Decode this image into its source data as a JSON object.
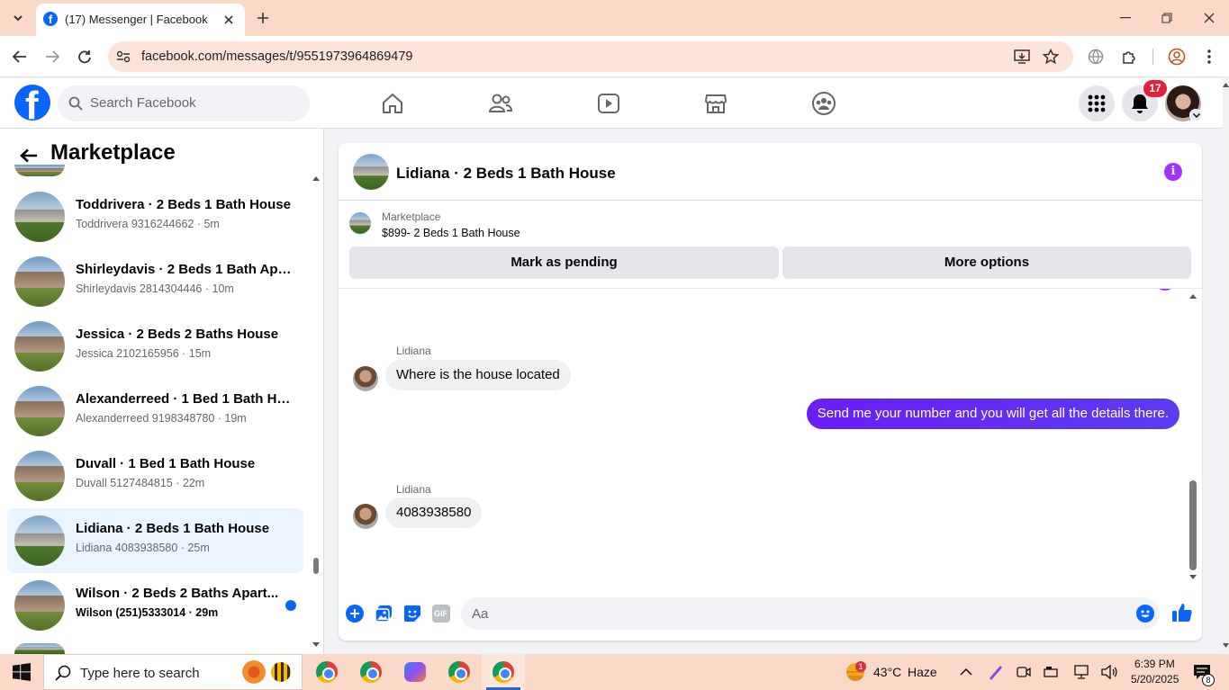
{
  "browser": {
    "tab_title": "(17) Messenger | Facebook",
    "url": "facebook.com/messages/t/9551973964869479"
  },
  "fb": {
    "search_placeholder": "Search Facebook",
    "notification_count": "17"
  },
  "sidebar": {
    "title": "Marketplace",
    "conversations": [
      {
        "name": "Toddrivera · 2 Beds 1 Bath House",
        "sub": "Toddrivera 9316244662 · 5m",
        "unread": false,
        "active": false
      },
      {
        "name": "Shirleydavis · 2 Beds 1 Bath Apar...",
        "sub": "Shirleydavis 2814304446 · 10m",
        "unread": false,
        "active": false
      },
      {
        "name": "Jessica · 2 Beds 2 Baths House",
        "sub": "Jessica 2102165956 · 15m",
        "unread": false,
        "active": false
      },
      {
        "name": "Alexanderreed · 1 Bed 1 Bath Ho...",
        "sub": "Alexanderreed 9198348780 · 19m",
        "unread": false,
        "active": false
      },
      {
        "name": "Duvall · 1 Bed 1 Bath House",
        "sub": "Duvall 5127484815 · 22m",
        "unread": false,
        "active": false
      },
      {
        "name": "Lidiana · 2 Beds 1 Bath House",
        "sub": "Lidiana 4083938580 · 25m",
        "unread": false,
        "active": true
      },
      {
        "name": "Wilson · 2 Beds 2 Baths Apart...",
        "sub": "Wilson (251)5333014 · 29m",
        "unread": true,
        "active": false
      }
    ]
  },
  "chat": {
    "title": "Lidiana · 2 Beds 1 Bath House",
    "listing_source": "Marketplace",
    "listing_detail": "$899- 2 Beds 1 Bath House",
    "mark_pending_label": "Mark as pending",
    "more_options_label": "More options",
    "messages": [
      {
        "sender": "Lidiana",
        "text": "Where is the house located",
        "direction": "in"
      },
      {
        "sender": "",
        "text": "Send me your number and you will get all the details there.",
        "direction": "out"
      },
      {
        "sender": "Lidiana",
        "text": "4083938580",
        "direction": "in"
      }
    ],
    "composer_placeholder": "Aa",
    "gif_label": "GIF"
  },
  "taskbar": {
    "search_placeholder": "Type here to search",
    "weather_temp": "43°C",
    "weather_text": "Haze",
    "weather_badge": "1",
    "time": "6:39 PM",
    "date": "5/20/2025",
    "notif_count": "8"
  },
  "colors": {
    "fb_blue": "#0866ff",
    "messenger_purple": "#5b2ff0",
    "info_purple": "#a033ff",
    "active_row": "#ebf5ff",
    "chrome_bg": "#fbd9c8"
  }
}
